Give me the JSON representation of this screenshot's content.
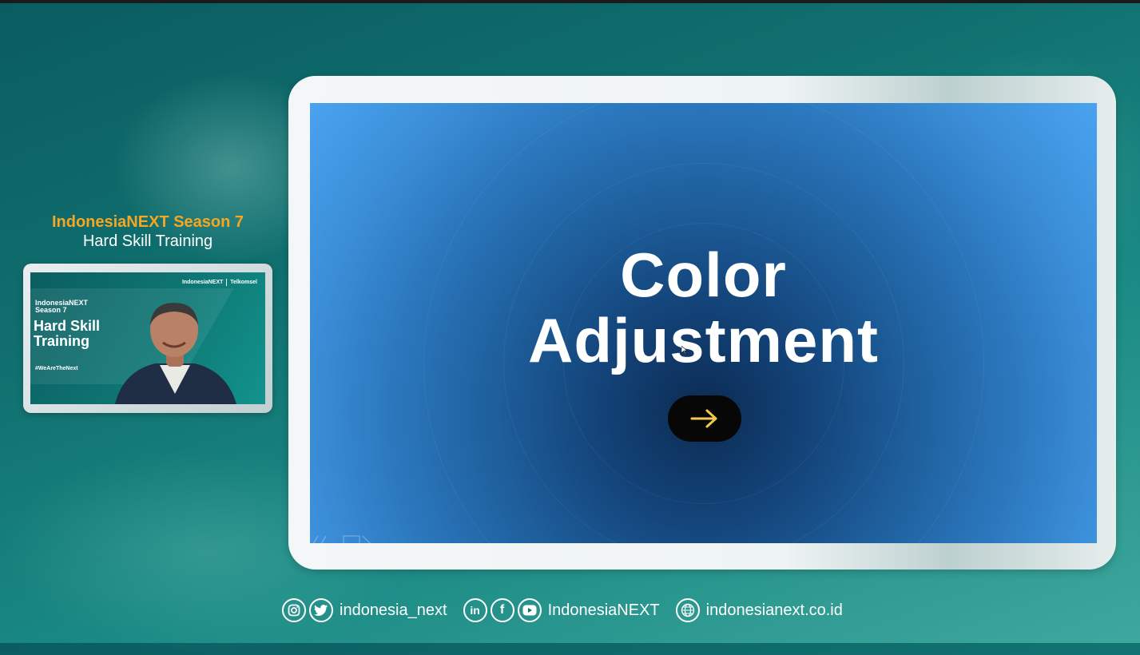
{
  "show": {
    "title_line1": "IndonesiaNEXT Season 7",
    "title_line2": "Hard Skill Training"
  },
  "camera": {
    "brand_left": "IndonesiaNEXT",
    "brand_right": "Telkomsel",
    "season": "IndonesiaNEXT Season 7",
    "heading": "Hard Skill Training",
    "hashtag": "#WeAreTheNext"
  },
  "slide": {
    "title_line1": "Color",
    "title_line2": "Adjustment",
    "next_icon": "arrow-right-icon",
    "arrow_color": "#f2c94c"
  },
  "footer": {
    "handle": "indonesia_next",
    "name": "IndonesiaNEXT",
    "website": "indonesianext.co.id",
    "icons": [
      "instagram-icon",
      "twitter-icon",
      "linkedin-icon",
      "facebook-icon",
      "youtube-icon",
      "globe-icon"
    ]
  },
  "colors": {
    "accent": "#f5a623",
    "background": "#10706f",
    "slide_blue": "#3b8fd8"
  }
}
